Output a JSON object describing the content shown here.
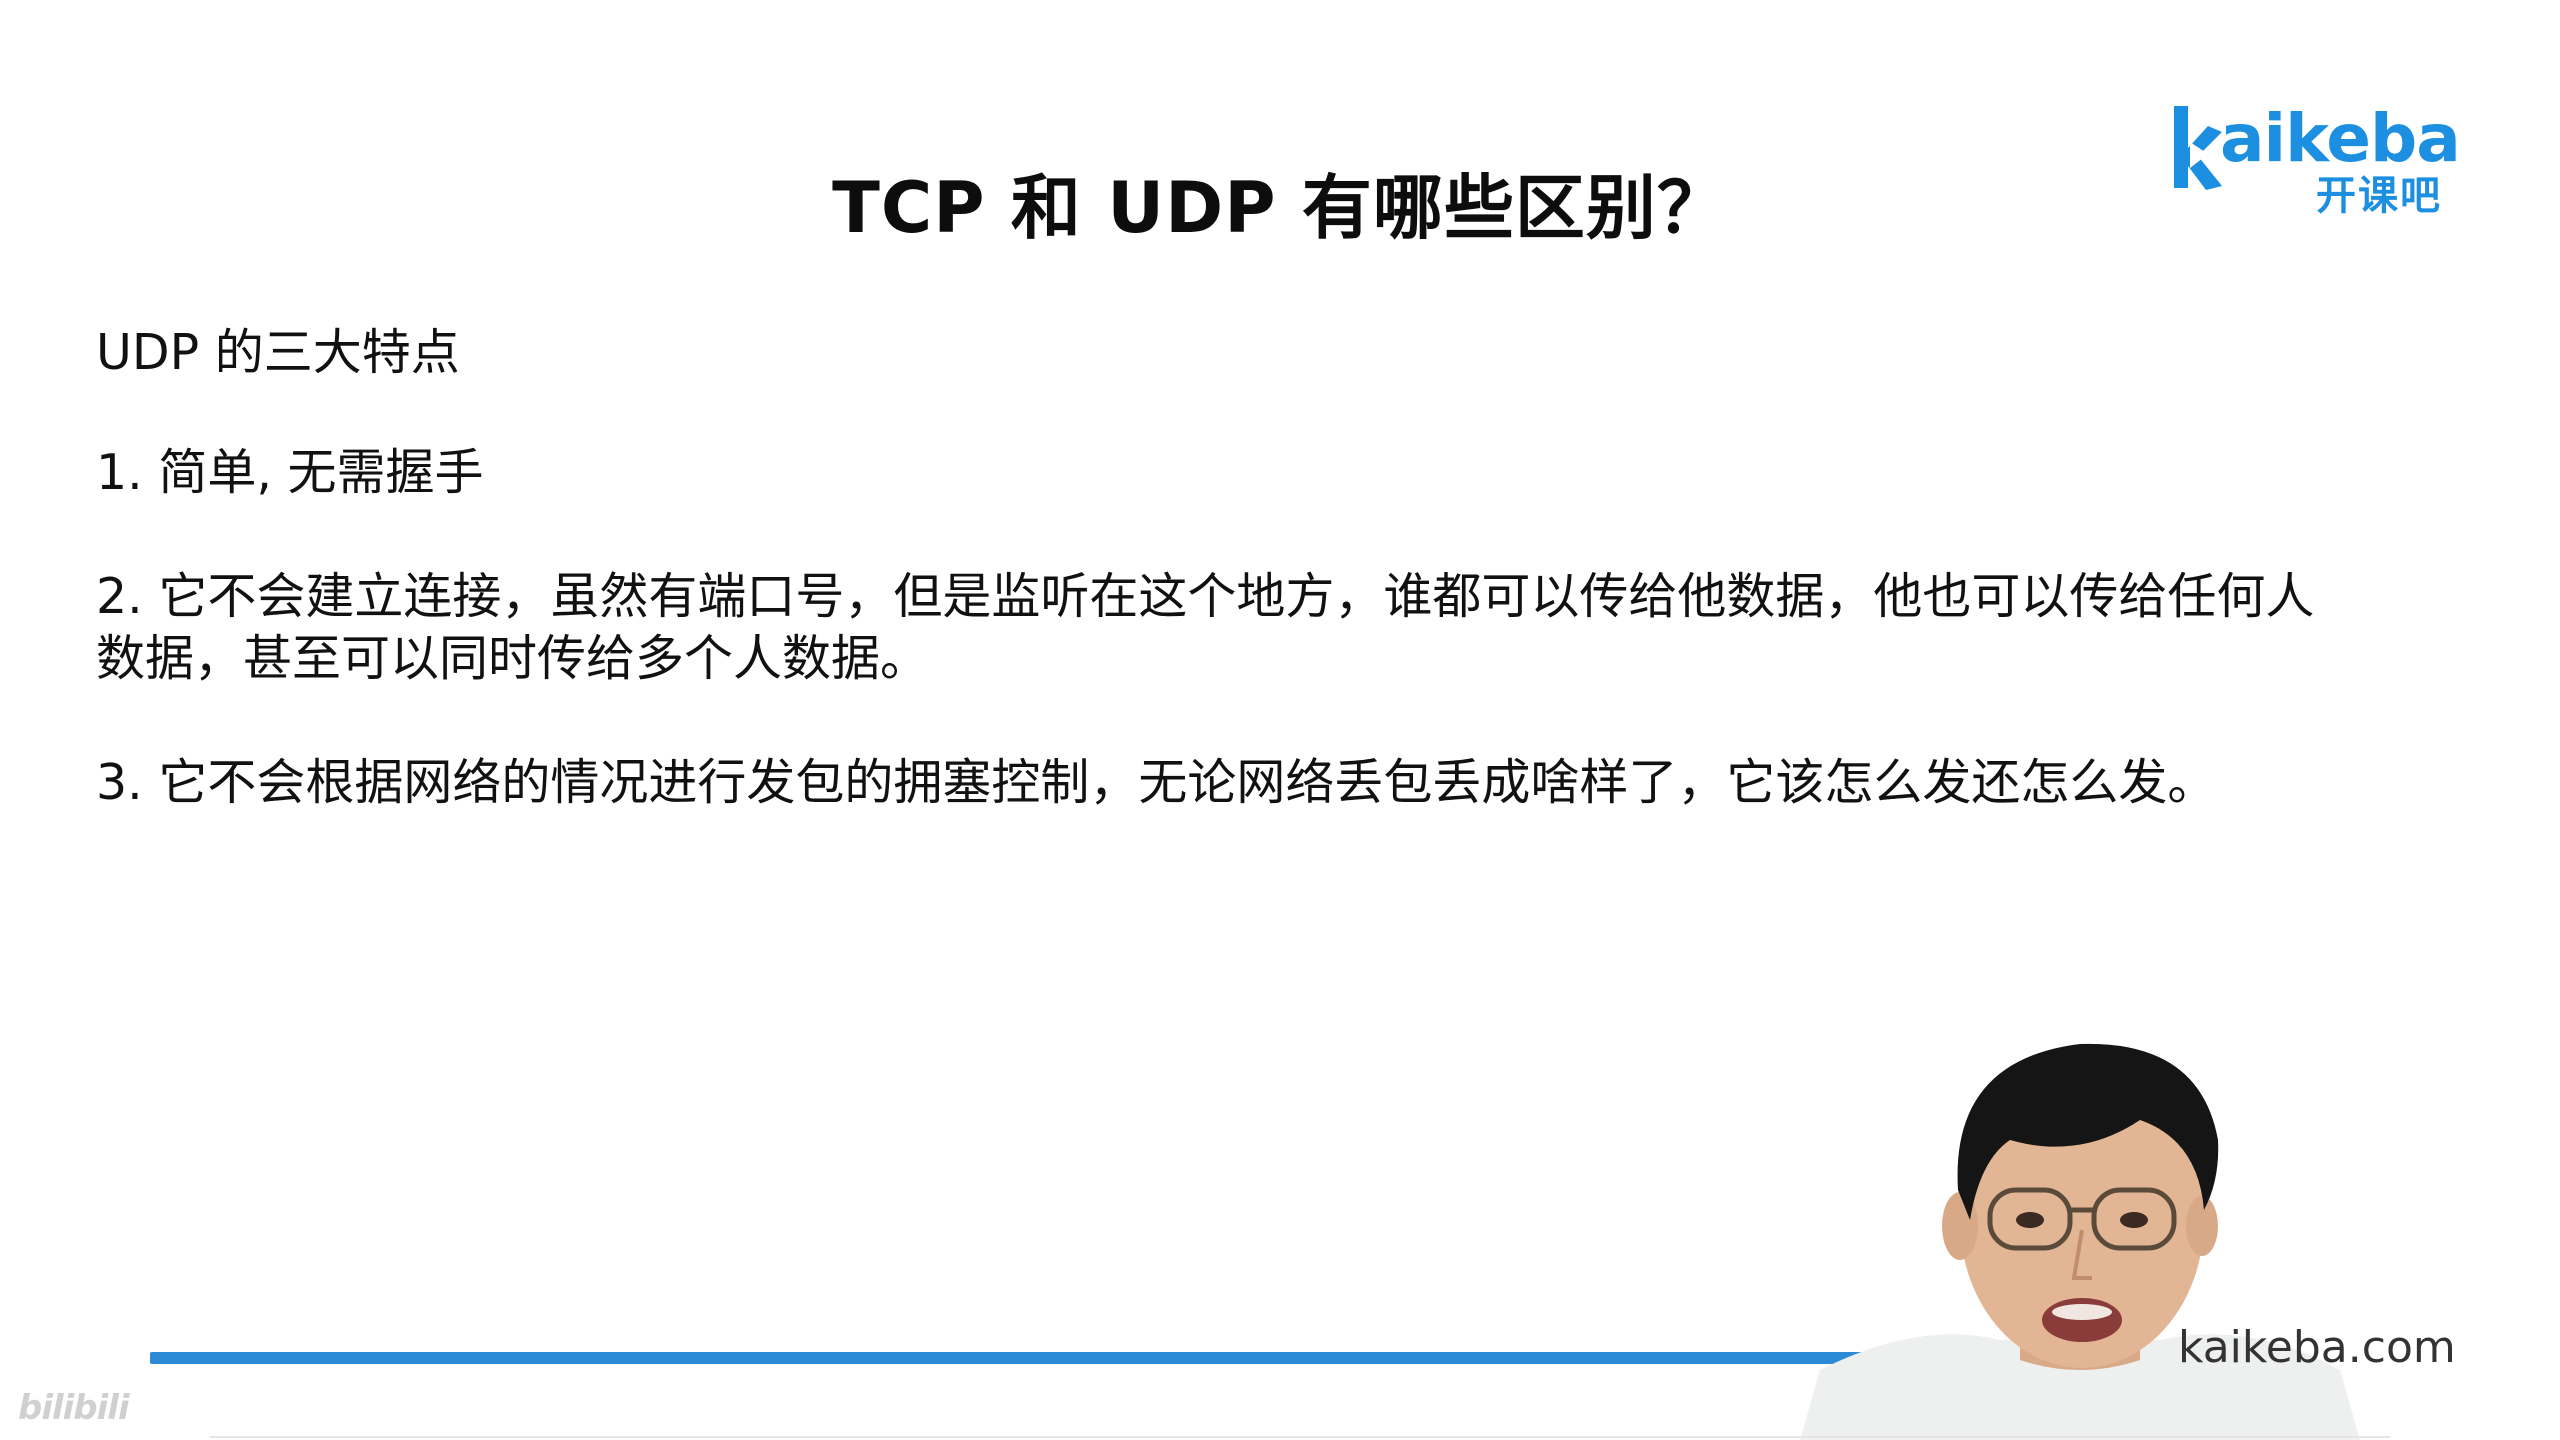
{
  "slide": {
    "title": "TCP 和 UDP 有哪些区别？",
    "heading": "UDP 的三大特点",
    "points": [
      "1. 简单, 无需握手",
      "2. 它不会建立连接，虽然有端口号，但是监听在这个地方，谁都可以传给他数据，他也可以传给任何人数据，甚至可以同时传给多个人数据。",
      "3. 它不会根据网络的情况进行发包的拥塞控制，无论网络丢包丢成啥样了，它该怎么发还怎么发。"
    ]
  },
  "logo": {
    "wordmark": "aikeba",
    "chinese": "开课吧",
    "brand_color": "#1d8fe1"
  },
  "footer": {
    "url": "kaikeba.com",
    "watermark": "bilibili"
  },
  "video": {
    "progress": 0.83,
    "progress_color": "#2d8bd6"
  }
}
